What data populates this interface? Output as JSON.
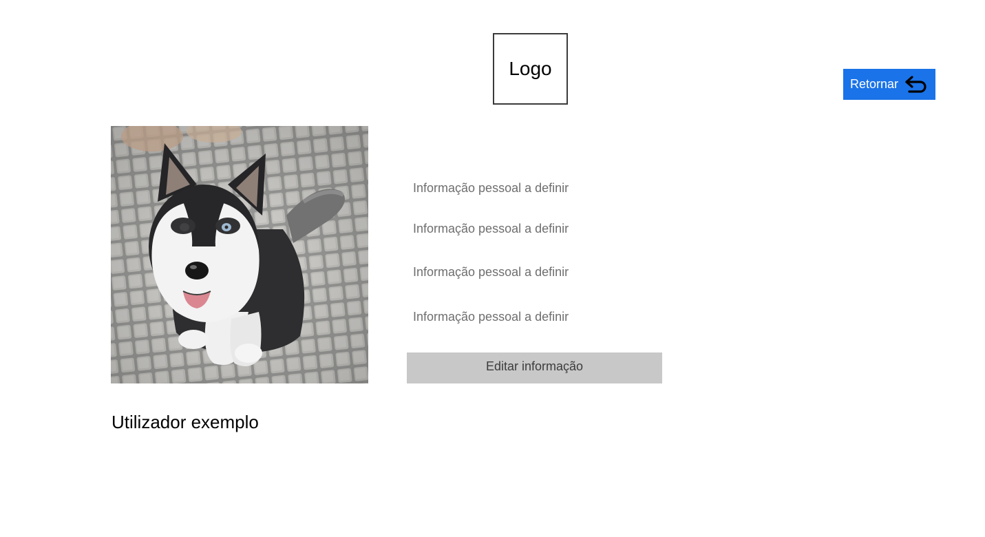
{
  "header": {
    "logo_text": "Logo"
  },
  "nav": {
    "back_label": "Retornar",
    "back_icon": "return-arrow-icon",
    "back_color": "#1a73e8"
  },
  "profile": {
    "photo_icon": "dog-photo",
    "info_lines": [
      "Informação pessoal a definir",
      "Informação pessoal a definir",
      "Informação pessoal a definir",
      "Informação pessoal a definir"
    ],
    "edit_label": "Editar informação",
    "username": "Utilizador exemplo"
  }
}
